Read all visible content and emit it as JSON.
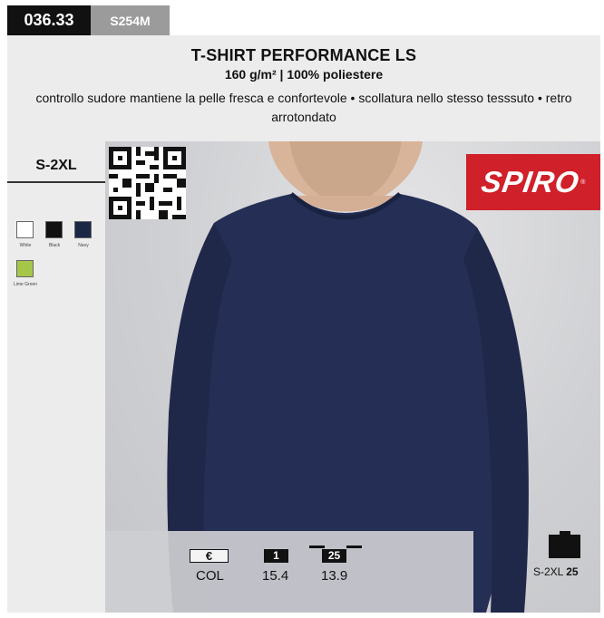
{
  "product": {
    "code": "036.33",
    "sku": "S254M",
    "title": "T-SHIRT PERFORMANCE LS",
    "subtitle": "160 g/m² | 100% poliestere",
    "description": "controllo sudore mantiene la pelle fresca e confortevole • scollatura nello stesso tesssuto • retro arrotondato",
    "brand": "SPIRO",
    "brand_mark": "®"
  },
  "sizes": "S-2XL",
  "colors": [
    {
      "name": "White",
      "hex": "#ffffff"
    },
    {
      "name": "Black",
      "hex": "#111111"
    },
    {
      "name": "Navy",
      "hex": "#1b2745"
    },
    {
      "name": "Lime Green",
      "hex": "#a6c64a"
    }
  ],
  "pricing": {
    "currency_label": "€",
    "color_label": "COL",
    "tiers": [
      {
        "qty": "1",
        "price": "15.4"
      },
      {
        "qty": "25",
        "price": "13.9"
      }
    ]
  },
  "carton": {
    "sizes": "S-2XL",
    "qty": "25"
  },
  "accent_colors": {
    "brand_red": "#d0202a",
    "header_bg": "#ececec",
    "shirt_navy": "#252f55"
  }
}
